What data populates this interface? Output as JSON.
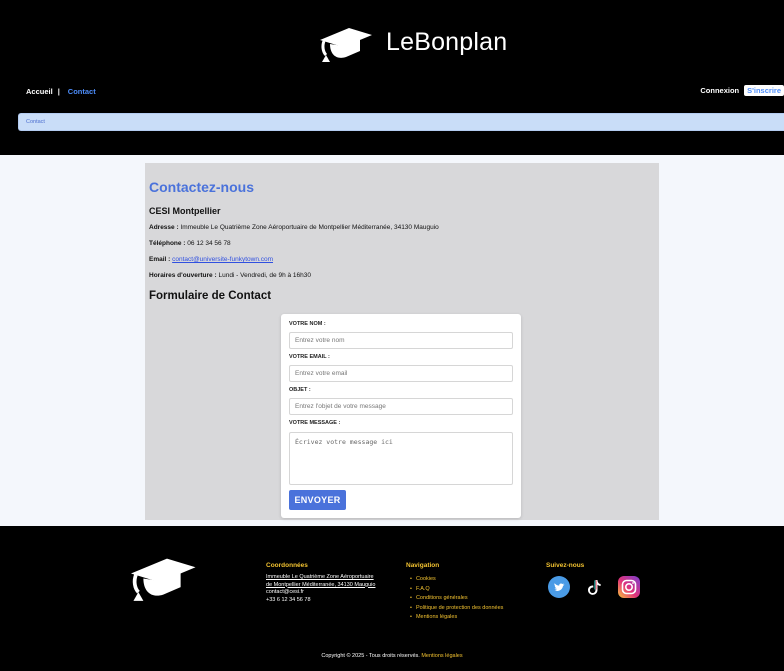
{
  "header": {
    "brand": "LeBonplan",
    "nav": {
      "home": "Accueil",
      "separator": "|",
      "contact": "Contact"
    },
    "login": "Connexion",
    "signup": "S'inscrire",
    "breadcrumb": "Contact"
  },
  "contact": {
    "title": "Contactez-nous",
    "campus": "CESI Montpellier",
    "address_label": "Adresse :",
    "address": "Immeuble Le Quatrième Zone Aéroportuaire de Montpellier Méditerranée, 34130 Mauguio",
    "phone_label": "Téléphone :",
    "phone": "06 12 34 56 78",
    "email_label": "Email :",
    "email": "contact@universite-funkytown.com",
    "hours_label": "Horaires d'ouverture :",
    "hours": "Lundi - Vendredi, de 9h à 16h30"
  },
  "form": {
    "title": "Formulaire de Contact",
    "name_label": "VOTRE NOM :",
    "name_placeholder": "Entrez votre nom",
    "email_label": "VOTRE EMAIL :",
    "email_placeholder": "Entrez votre email",
    "subject_label": "OBJET :",
    "subject_placeholder": "Entrez l'objet de votre message",
    "message_label": "VOTRE MESSAGE :",
    "message_placeholder": "Écrivez votre message ici",
    "submit": "ENVOYER"
  },
  "footer": {
    "coords_title": "Coordonnées",
    "address_line1": "Immeuble Le Quatrième Zone Aéroportuaire",
    "address_line2": "de Montpellier Méditerranée, 34130 Mauguio",
    "email": "contact@cesi.fr",
    "phone": "+33 6 12 34 56 78",
    "nav_title": "Navigation",
    "nav_items": [
      "Cookies",
      "F.A.Q",
      "Conditions générales",
      "Politique de protection des données",
      "Mentions légales"
    ],
    "social_title": "Suivez-nous",
    "social_icons": [
      "twitter-icon",
      "tiktok-icon",
      "instagram-icon"
    ],
    "copyright": "Copyright © 2025 - Tous droits réservés.",
    "copyright_link": "Mentions légales"
  },
  "colors": {
    "accent": "#4a72db",
    "link_blue": "#4d8dfa",
    "footer_yellow": "#f2c230",
    "header_bg": "#000000"
  }
}
